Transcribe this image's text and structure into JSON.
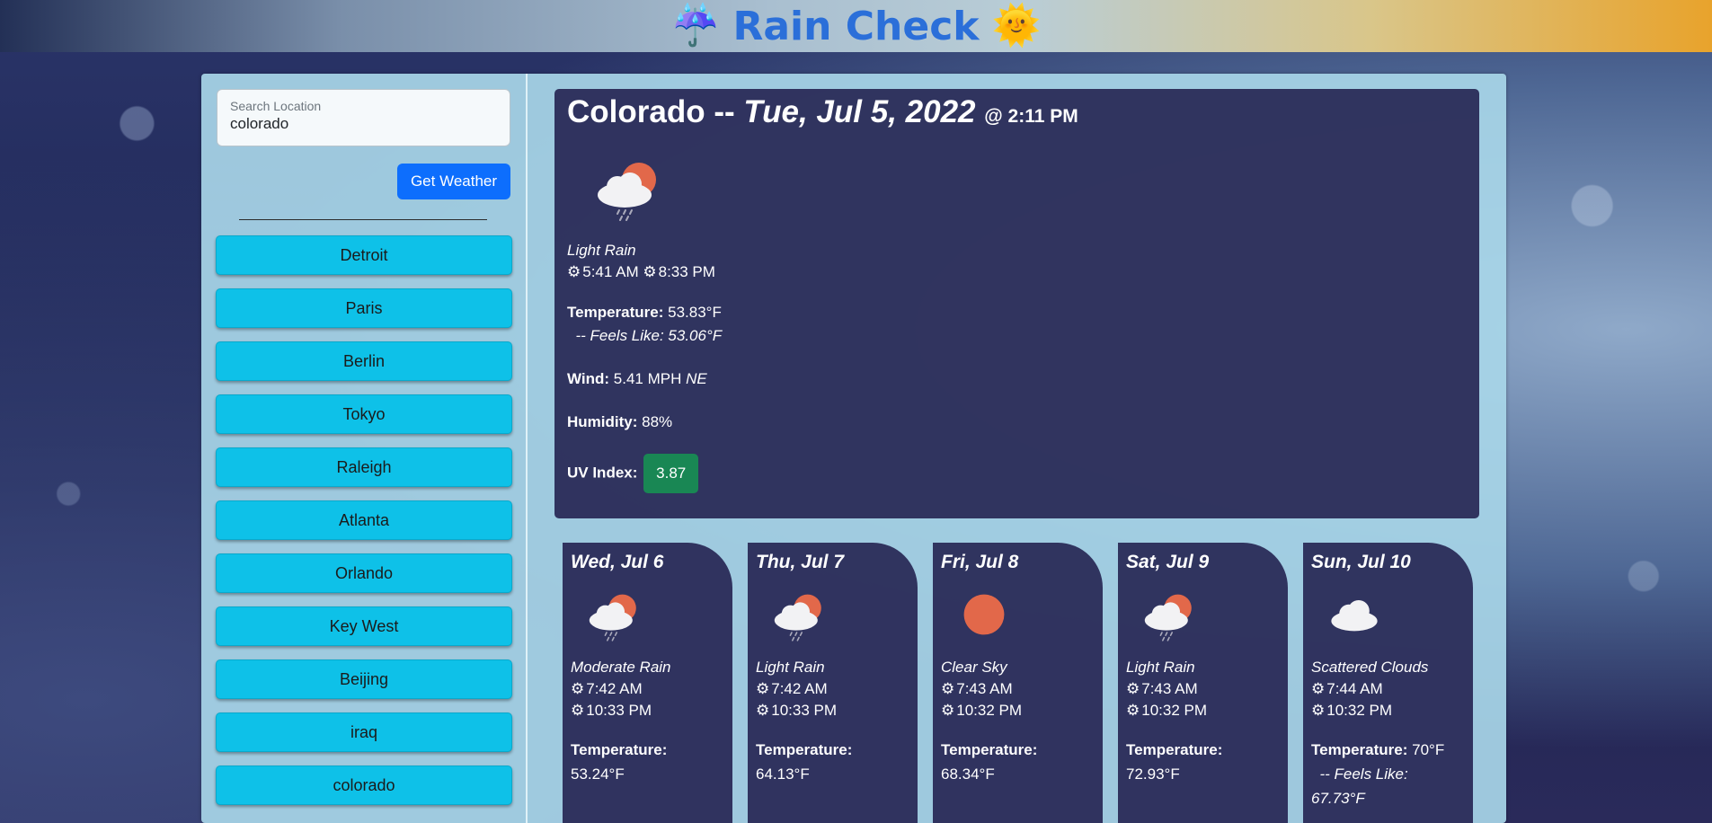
{
  "header": {
    "title": "Rain Check",
    "left_icon": "umbrella-icon",
    "right_icon": "sun-icon"
  },
  "search": {
    "label": "Search Location",
    "value": "colorado",
    "button": "Get Weather"
  },
  "history": [
    "Detroit",
    "Paris",
    "Berlin",
    "Tokyo",
    "Raleigh",
    "Atlanta",
    "Orlando",
    "Key West",
    "Beijing",
    "iraq",
    "colorado"
  ],
  "current": {
    "city": "Colorado",
    "separator": "--",
    "date": "Tue, Jul 5, 2022",
    "time": "@ 2:11 PM",
    "icon": "cloud-sun-rain-icon",
    "description": "Light Rain",
    "sunrise": "5:41 AM",
    "sunset": "8:33 PM",
    "temperature_label": "Temperature:",
    "temperature": "53.83°F",
    "feels_like": "-- Feels Like: 53.06°F",
    "wind_label": "Wind:",
    "wind": "5.41 MPH",
    "wind_dir": "NE",
    "humidity_label": "Humidity:",
    "humidity": "88%",
    "uv_label": "UV Index:",
    "uv": "3.87",
    "uv_color": "#198754"
  },
  "forecast": [
    {
      "day": "Wed, Jul 6",
      "icon": "cloud-sun-rain-icon",
      "description": "Moderate Rain",
      "sunrise": "7:42 AM",
      "sunset": "10:33 PM",
      "temperature_label": "Temperature:",
      "temperature": "53.24°F"
    },
    {
      "day": "Thu, Jul 7",
      "icon": "cloud-sun-rain-icon",
      "description": "Light Rain",
      "sunrise": "7:42 AM",
      "sunset": "10:33 PM",
      "temperature_label": "Temperature:",
      "temperature": "64.13°F"
    },
    {
      "day": "Fri, Jul 8",
      "icon": "sun-icon",
      "description": "Clear Sky",
      "sunrise": "7:43 AM",
      "sunset": "10:32 PM",
      "temperature_label": "Temperature:",
      "temperature": "68.34°F"
    },
    {
      "day": "Sat, Jul 9",
      "icon": "cloud-sun-rain-icon",
      "description": "Light Rain",
      "sunrise": "7:43 AM",
      "sunset": "10:32 PM",
      "temperature_label": "Temperature:",
      "temperature": "72.93°F"
    },
    {
      "day": "Sun, Jul 10",
      "icon": "cloud-icon",
      "description": "Scattered Clouds",
      "sunrise": "7:44 AM",
      "sunset": "10:32 PM",
      "temperature_label": "Temperature:",
      "temperature": "70°F",
      "feels_like": "-- Feels Like: 67.73°F"
    }
  ],
  "colors": {
    "accent": "#0d6efd",
    "history_button": "#0ec1e8",
    "card": "#282855",
    "title": "#2b6fd9"
  }
}
